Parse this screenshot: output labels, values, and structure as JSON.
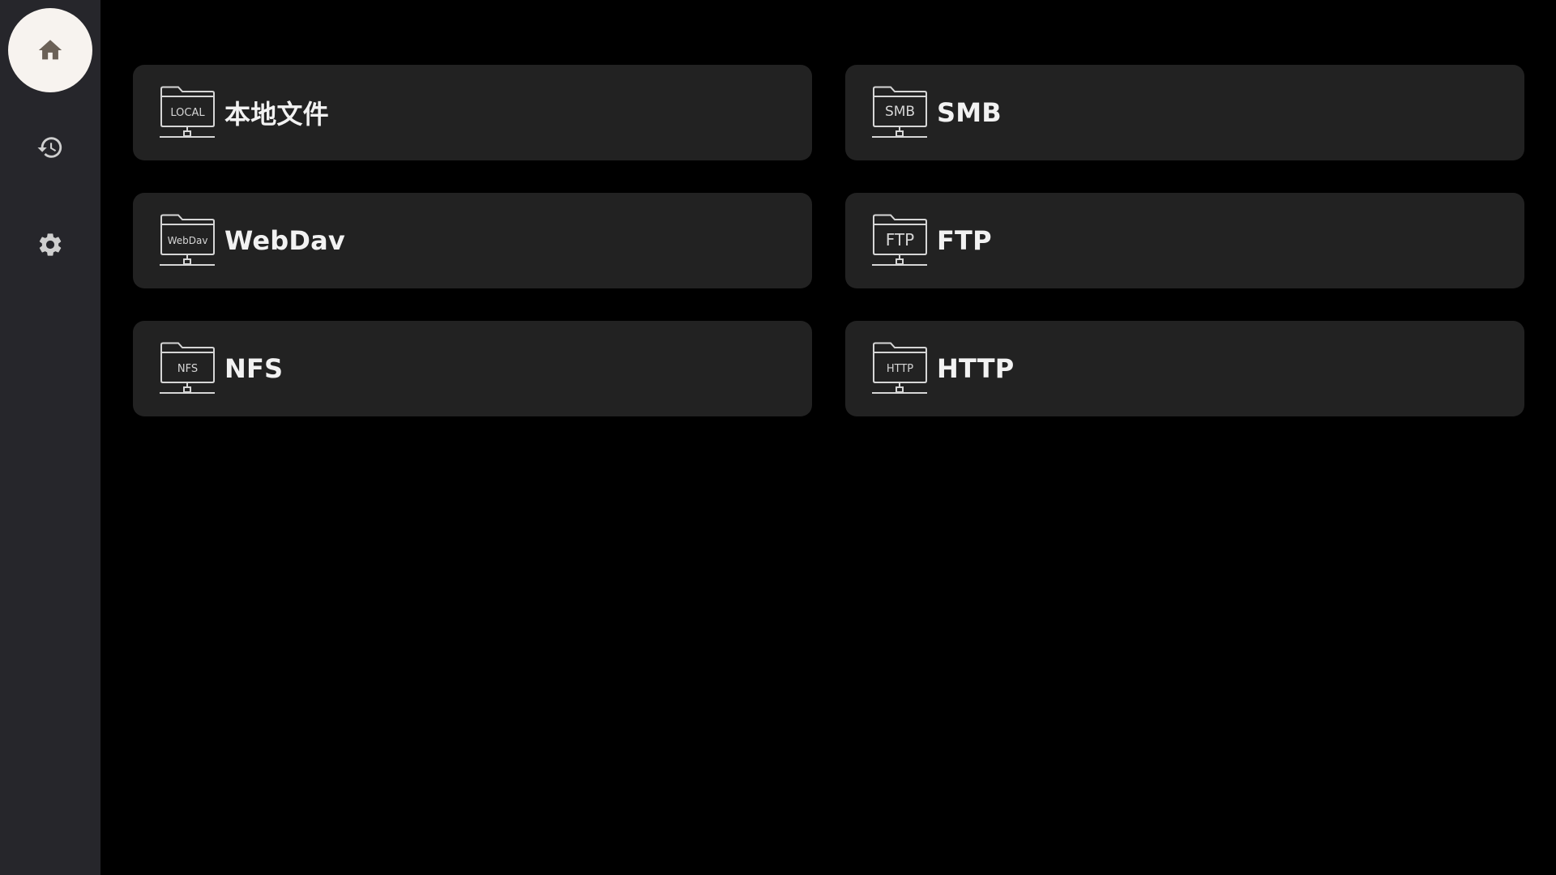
{
  "nav": {
    "items": [
      {
        "icon": "home-icon",
        "active": true
      },
      {
        "icon": "history-icon",
        "active": false
      },
      {
        "icon": "gear-icon",
        "active": false
      }
    ],
    "active_color": "#f7f3ef",
    "icon_color_active": "#6b6157",
    "icon_color": "#cfcfcf"
  },
  "sources": [
    {
      "label": "本地文件",
      "badge": "LOCAL"
    },
    {
      "label": "SMB",
      "badge": "SMB"
    },
    {
      "label": "WebDav",
      "badge": "WebDav"
    },
    {
      "label": "FTP",
      "badge": "FTP"
    },
    {
      "label": "NFS",
      "badge": "NFS"
    },
    {
      "label": "HTTP",
      "badge": "HTTP"
    }
  ]
}
